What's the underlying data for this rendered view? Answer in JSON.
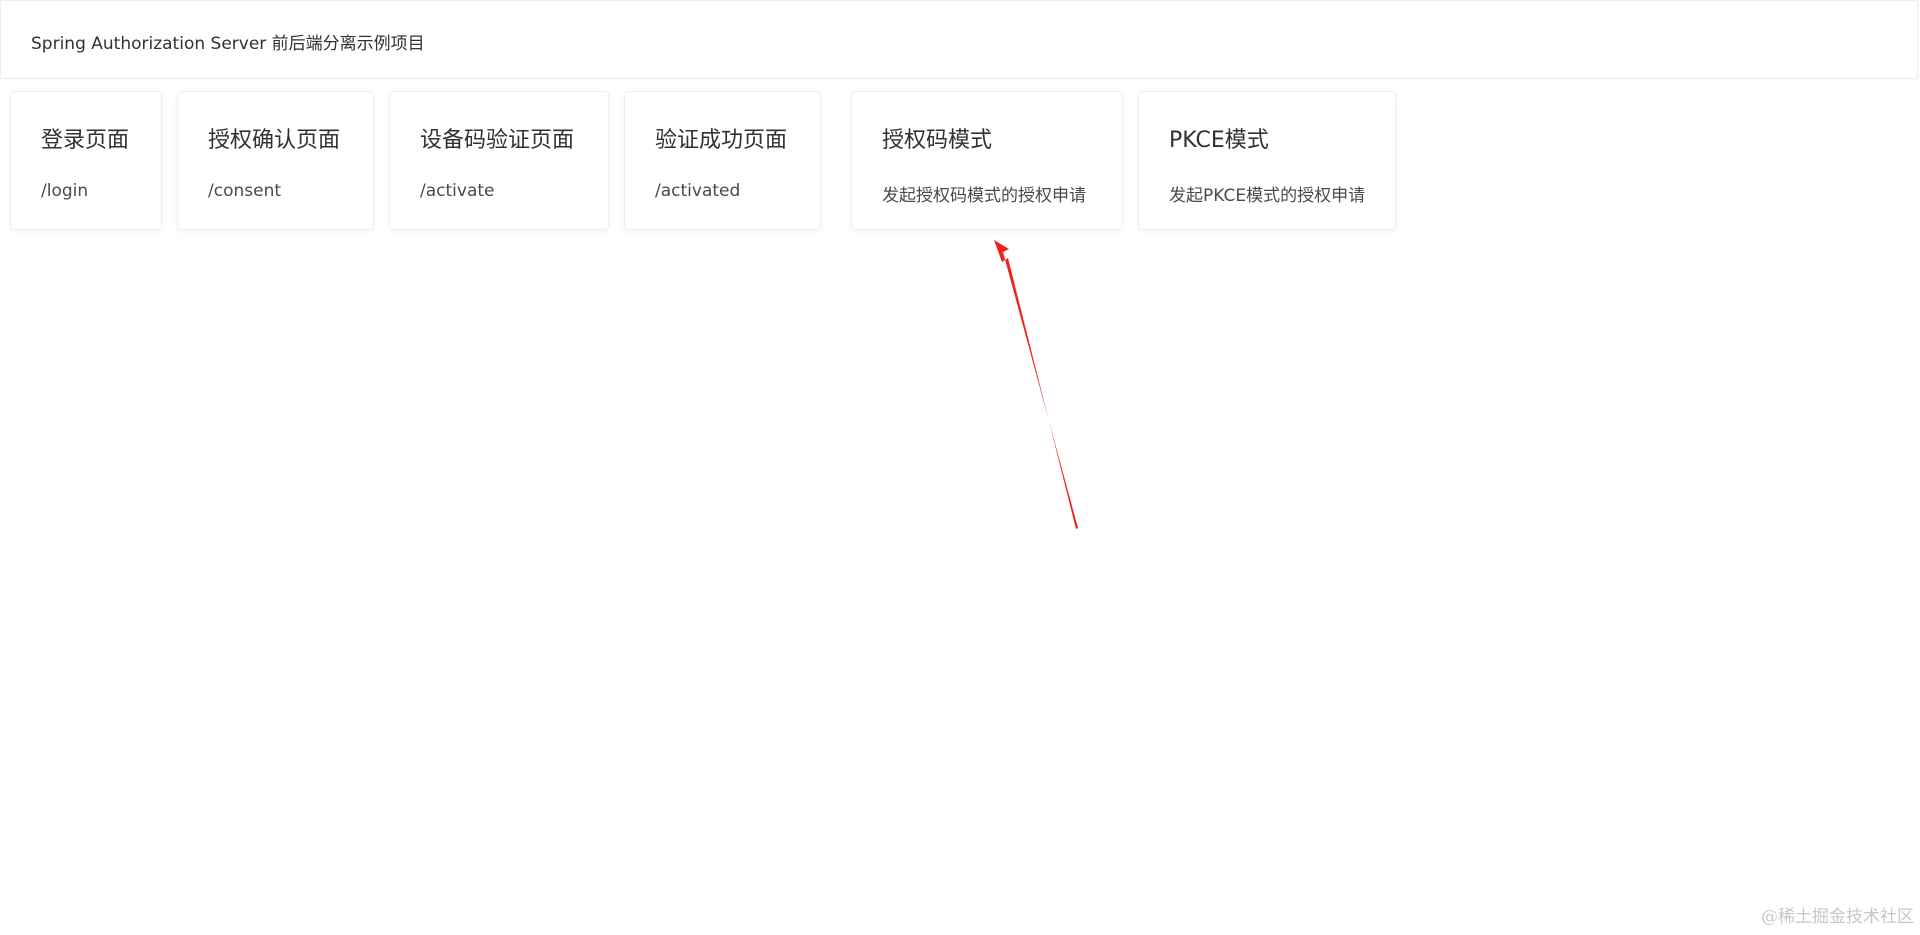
{
  "header": {
    "title": "Spring Authorization Server 前后端分离示例项目"
  },
  "cards": [
    {
      "title": "登录页面",
      "desc": "/login"
    },
    {
      "title": "授权确认页面",
      "desc": "/consent"
    },
    {
      "title": "设备码验证页面",
      "desc": "/activate"
    },
    {
      "title": "验证成功页面",
      "desc": "/activated"
    },
    {
      "title": "授权码模式",
      "desc": "发起授权码模式的授权申请"
    },
    {
      "title": "PKCE模式",
      "desc": "发起PKCE模式的授权申请"
    }
  ],
  "watermark": "@稀土掘金技术社区",
  "colors": {
    "annotation_arrow": "#f0201a",
    "card_border": "#ebeef5"
  }
}
